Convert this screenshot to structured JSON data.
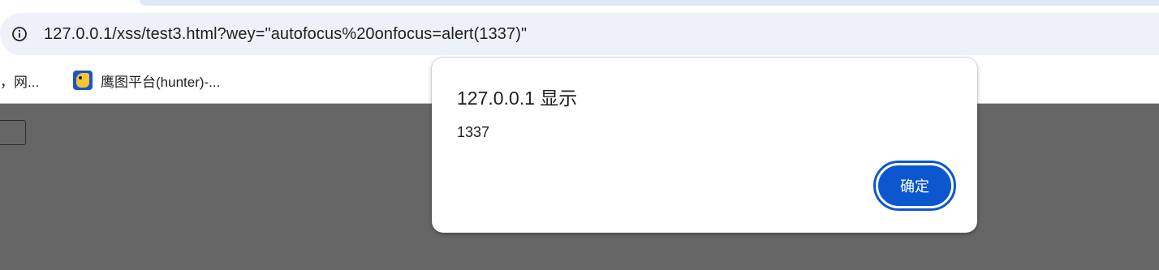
{
  "browser": {
    "address_bar": {
      "url": "127.0.0.1/xss/test3.html?wey=\"autofocus%20onfocus=alert(1337)\"",
      "site_info_icon": "info-circle-icon"
    },
    "bookmarks": [
      {
        "label": "，网...",
        "icon": ""
      },
      {
        "label": "鹰图平台(hunter)-...",
        "icon": "hunter-bird-favicon"
      }
    ]
  },
  "dialog": {
    "title": "127.0.0.1 显示",
    "message": "1337",
    "ok_label": "确定"
  },
  "colors": {
    "omnibox_bg": "#edf2fa",
    "overlay": "#666666",
    "primary_button": "#0b57d0"
  }
}
